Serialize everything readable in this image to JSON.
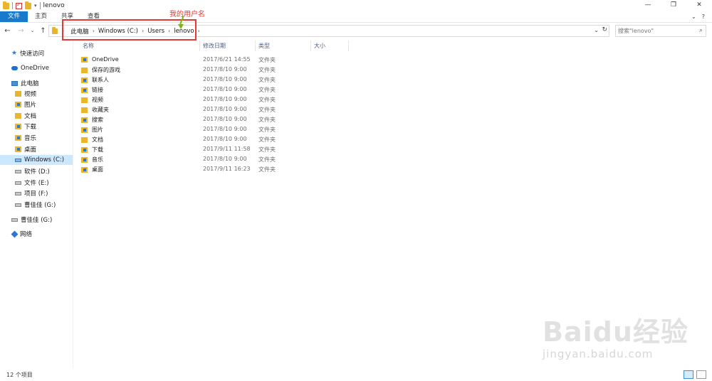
{
  "window": {
    "title": "lenovo",
    "controls": [
      "—",
      "❐",
      "✕"
    ]
  },
  "ribbon": {
    "tabs": [
      "文件",
      "主页",
      "共享",
      "查看"
    ]
  },
  "address": {
    "crumbs": [
      "此电脑",
      "Windows (C:)",
      "Users",
      "lenovo"
    ],
    "search_placeholder": "搜索\"lenovo\""
  },
  "annotation": {
    "label": "我的用户名",
    "color": "#e53935"
  },
  "sidebar": {
    "items": [
      {
        "label": "快速访问",
        "icon": "star-icon"
      },
      {
        "label": "OneDrive",
        "icon": "cloud-icon"
      },
      {
        "label": "此电脑",
        "icon": "computer-icon"
      },
      {
        "label": "视频",
        "icon": "videos-folder-icon"
      },
      {
        "label": "图片",
        "icon": "pictures-folder-icon"
      },
      {
        "label": "文档",
        "icon": "documents-folder-icon"
      },
      {
        "label": "下载",
        "icon": "downloads-folder-icon"
      },
      {
        "label": "音乐",
        "icon": "music-folder-icon"
      },
      {
        "label": "桌面",
        "icon": "desktop-folder-icon"
      },
      {
        "label": "Windows (C:)",
        "icon": "windows-drive-icon"
      },
      {
        "label": "软件 (D:)",
        "icon": "drive-icon"
      },
      {
        "label": "文件 (E:)",
        "icon": "drive-icon"
      },
      {
        "label": "项目 (F:)",
        "icon": "drive-icon"
      },
      {
        "label": "曹佳佳 (G:)",
        "icon": "drive-icon"
      },
      {
        "label": "曹佳佳 (G:)",
        "icon": "usb-drive-icon"
      },
      {
        "label": "网络",
        "icon": "network-icon"
      }
    ]
  },
  "columns": [
    "名称",
    "修改日期",
    "类型",
    "大小"
  ],
  "files": [
    {
      "name": "OneDrive",
      "date": "2017/6/21 14:55",
      "type": "文件夹"
    },
    {
      "name": "保存的游戏",
      "date": "2017/8/10 9:00",
      "type": "文件夹"
    },
    {
      "name": "联系人",
      "date": "2017/8/10 9:00",
      "type": "文件夹"
    },
    {
      "name": "链接",
      "date": "2017/8/10 9:00",
      "type": "文件夹"
    },
    {
      "name": "视频",
      "date": "2017/8/10 9:00",
      "type": "文件夹"
    },
    {
      "name": "收藏夹",
      "date": "2017/8/10 9:00",
      "type": "文件夹"
    },
    {
      "name": "搜索",
      "date": "2017/8/10 9:00",
      "type": "文件夹"
    },
    {
      "name": "图片",
      "date": "2017/8/10 9:00",
      "type": "文件夹"
    },
    {
      "name": "文档",
      "date": "2017/8/10 9:00",
      "type": "文件夹"
    },
    {
      "name": "下载",
      "date": "2017/9/11 11:58",
      "type": "文件夹"
    },
    {
      "name": "音乐",
      "date": "2017/8/10 9:00",
      "type": "文件夹"
    },
    {
      "name": "桌面",
      "date": "2017/9/11 16:23",
      "type": "文件夹"
    }
  ],
  "status": {
    "count": "12 个项目"
  },
  "watermark": {
    "logo": "Baidu经验",
    "sub": "jingyan.baidu.com"
  }
}
